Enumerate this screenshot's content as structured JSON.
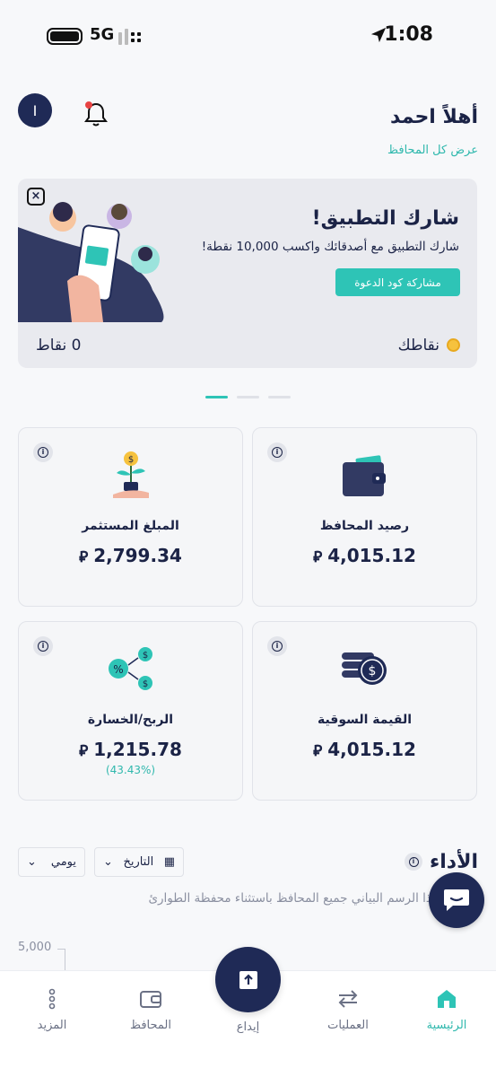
{
  "status_bar": {
    "time": "1:08",
    "network": "5G"
  },
  "header": {
    "avatar_initial": "I",
    "greeting": "أهلاً احمد",
    "view_all": "عرض كل المحافظ"
  },
  "banner": {
    "title": "شارك التطبيق!",
    "subtitle": "شارك التطبيق مع أصدقائك واكسب 10,000 نقطة!",
    "button": "مشاركة كود الدعوة",
    "points_label": "نقاطك",
    "points_value": "0 نقاط"
  },
  "cards": [
    {
      "label": "رصيد المحافظ",
      "value": "4,015.12",
      "currency": "⃁"
    },
    {
      "label": "المبلغ المستثمر",
      "value": "2,799.34",
      "currency": "⃁"
    },
    {
      "label": "القيمة السوقية",
      "value": "4,015.12",
      "currency": "⃁"
    },
    {
      "label": "الربح/الخسارة",
      "value": "1,215.78",
      "currency": "⃁",
      "percent": "(43.43%)"
    }
  ],
  "performance": {
    "title": "الأداء",
    "date_select": "التاريخ",
    "period_select": "يومي",
    "description": "يتضمن هذا الرسم البياني جميع المحافظ باستثناء محفظة الطوارئ",
    "y_tick": "5,000"
  },
  "nav": {
    "home": "الرئيسية",
    "operations": "العمليات",
    "deposit": "إيداع",
    "wallets": "المحافظ",
    "more": "المزيد"
  },
  "colors": {
    "primary": "#1f2a56",
    "accent": "#2ec4b6",
    "bg": "#f7f8fa"
  }
}
